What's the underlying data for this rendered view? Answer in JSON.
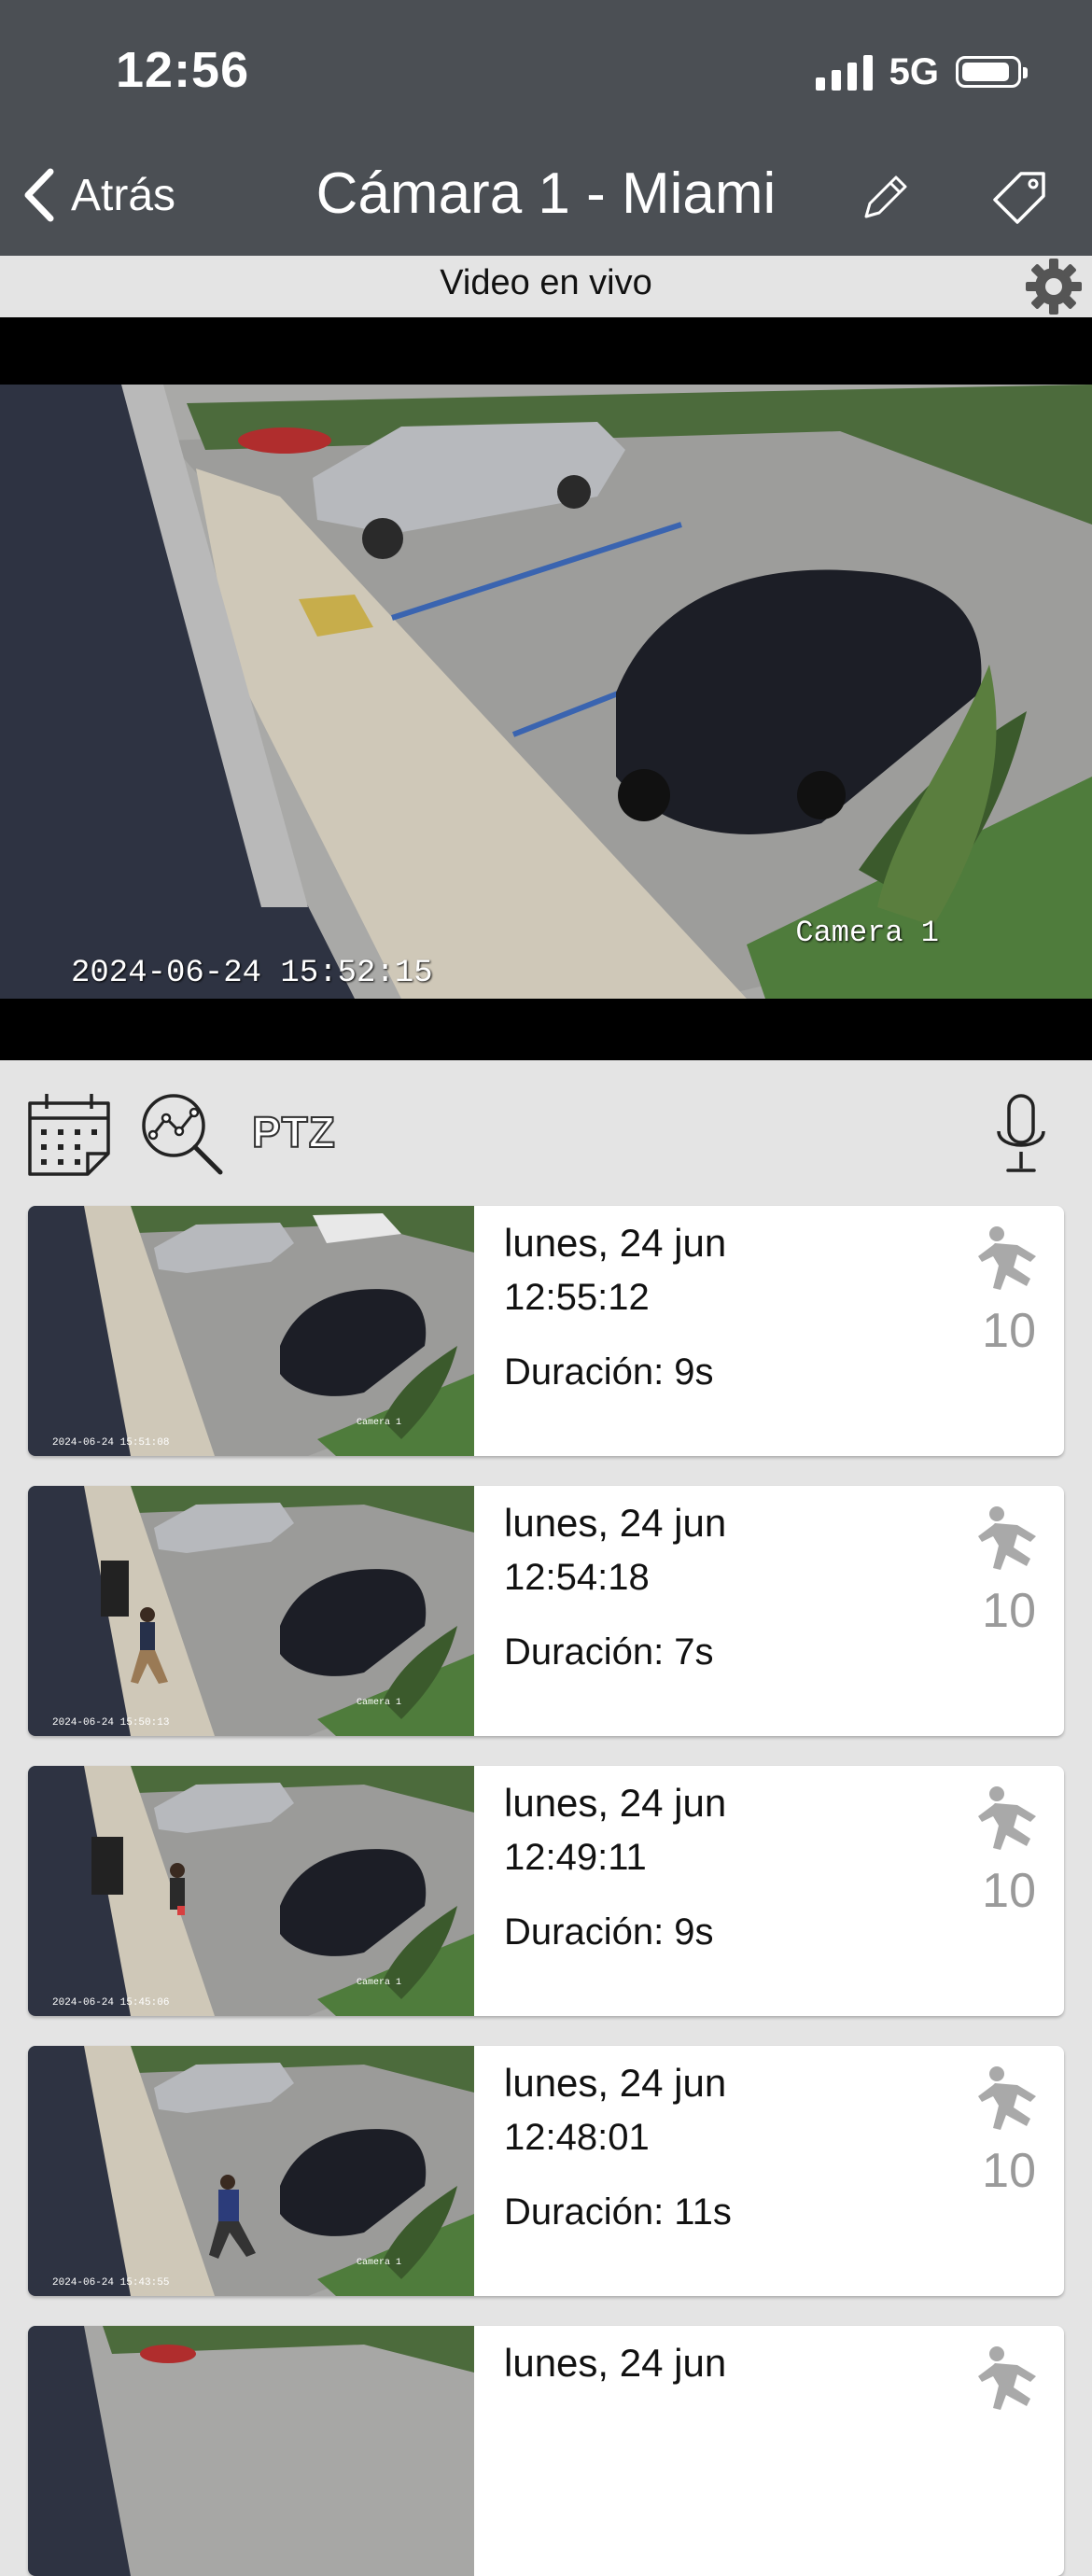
{
  "status": {
    "time": "12:56",
    "network": "5G"
  },
  "nav": {
    "back_label": "Atrás",
    "title": "Cámara 1 - Miami"
  },
  "live": {
    "label": "Video en vivo"
  },
  "video": {
    "timestamp": "2024-06-24 15:52:15",
    "camera_label": "Camera 1"
  },
  "toolbar": {
    "ptz_label": "PTZ"
  },
  "events": [
    {
      "date": "lunes, 24 jun",
      "time": "12:55:12",
      "duration": "Duración: 9s",
      "count": "10",
      "thumb_stamp": "2024-06-24 15:51:08",
      "thumb_cam": "Camera 1"
    },
    {
      "date": "lunes, 24 jun",
      "time": "12:54:18",
      "duration": "Duración: 7s",
      "count": "10",
      "thumb_stamp": "2024-06-24 15:50:13",
      "thumb_cam": "Camera 1"
    },
    {
      "date": "lunes, 24 jun",
      "time": "12:49:11",
      "duration": "Duración: 9s",
      "count": "10",
      "thumb_stamp": "2024-06-24 15:45:06",
      "thumb_cam": "Camera 1"
    },
    {
      "date": "lunes, 24 jun",
      "time": "12:48:01",
      "duration": "Duración: 11s",
      "count": "10",
      "thumb_stamp": "2024-06-24 15:43:55",
      "thumb_cam": "Camera 1"
    },
    {
      "date": "lunes, 24 jun",
      "time": "",
      "duration": "",
      "count": "",
      "thumb_stamp": "",
      "thumb_cam": ""
    }
  ],
  "icons": {
    "back": "chevron-left-icon",
    "edit": "pencil-icon",
    "tag": "tag-icon",
    "settings": "gear-icon",
    "calendar": "calendar-icon",
    "search": "magnify-chart-icon",
    "mic": "microphone-icon",
    "motion": "running-person-icon"
  },
  "colors": {
    "header": "#4b4f54",
    "background": "#e4e4e4",
    "count": "#9a9a9a"
  }
}
